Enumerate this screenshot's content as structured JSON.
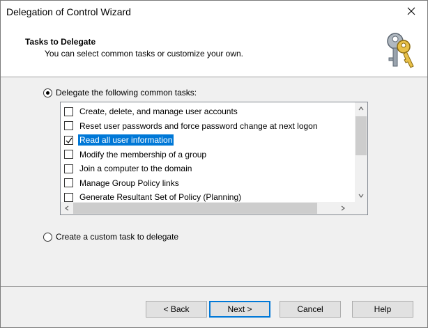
{
  "window": {
    "title": "Delegation of Control Wizard"
  },
  "header": {
    "title": "Tasks to Delegate",
    "subtitle": "You can select common tasks or customize your own."
  },
  "options": {
    "common_label": "Delegate the following common tasks:",
    "common_selected": true,
    "custom_label": "Create a custom task to delegate",
    "custom_selected": false
  },
  "tasks": [
    {
      "label": "Create, delete, and manage user accounts",
      "checked": false,
      "selected": false
    },
    {
      "label": "Reset user passwords and force password change at next logon",
      "checked": false,
      "selected": false
    },
    {
      "label": "Read all user information",
      "checked": true,
      "selected": true
    },
    {
      "label": "Modify the membership of a group",
      "checked": false,
      "selected": false
    },
    {
      "label": "Join a computer to the domain",
      "checked": false,
      "selected": false
    },
    {
      "label": "Manage Group Policy links",
      "checked": false,
      "selected": false
    },
    {
      "label": "Generate Resultant Set of Policy (Planning)",
      "checked": false,
      "selected": false
    }
  ],
  "buttons": {
    "back": "< Back",
    "next": "Next >",
    "cancel": "Cancel",
    "help": "Help"
  },
  "colors": {
    "selection": "#0078d7",
    "dialog_bg": "#f0f0f0"
  }
}
